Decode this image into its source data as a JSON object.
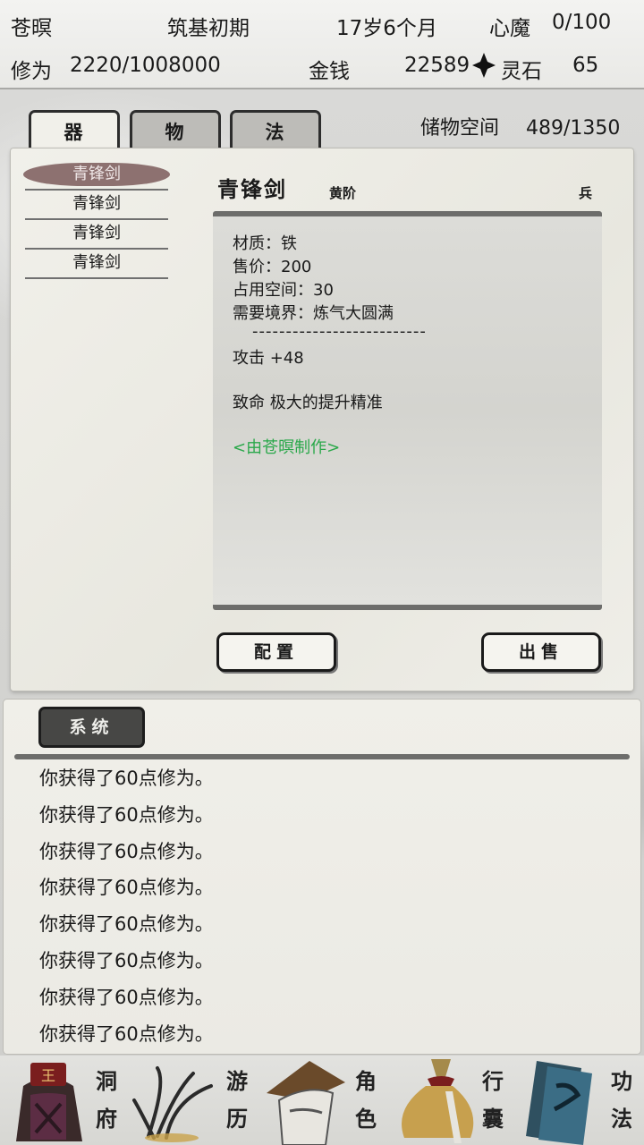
{
  "status": {
    "name": "苍暝",
    "realm": "筑基初期",
    "age": "17岁6个月",
    "demon_label": "心魔",
    "demon_value": "0/100",
    "cultivation_label": "修为",
    "cultivation_value": "2220/1008000",
    "money_label": "金钱",
    "money_value": "22589",
    "spirit_label": "灵石",
    "spirit_value": "65"
  },
  "tabs": [
    {
      "label": "器"
    },
    {
      "label": "物"
    },
    {
      "label": "法"
    }
  ],
  "storage": {
    "label": "储物空间",
    "value": "489/1350"
  },
  "items": [
    {
      "label": "青锋剑"
    },
    {
      "label": "青锋剑"
    },
    {
      "label": "青锋剑"
    },
    {
      "label": "青锋剑"
    }
  ],
  "detail": {
    "name": "青锋剑",
    "grade": "黄阶",
    "type": "兵",
    "lines": [
      "材质：铁",
      "售价：200",
      "占用空间：30",
      "需要境界：炼气大圆满",
      "--------------------------",
      "攻击 +48",
      "致命 极大的提升精准",
      "<由苍暝制作>"
    ]
  },
  "buttons": {
    "equip": "配置",
    "sell": "出售"
  },
  "log": {
    "tab_label": "系统",
    "lines": [
      "你获得了60点修为。",
      "你获得了60点修为。",
      "你获得了60点修为。",
      "你获得了60点修为。",
      "你获得了60点修为。",
      "你获得了60点修为。",
      "你获得了60点修为。",
      "你获得了60点修为。"
    ]
  },
  "nav": [
    {
      "top": "洞",
      "bottom": "府",
      "icon": "cave-dwelling-icon"
    },
    {
      "top": "游",
      "bottom": "历",
      "icon": "travel-icon"
    },
    {
      "top": "角",
      "bottom": "色",
      "icon": "character-icon"
    },
    {
      "top": "行",
      "bottom": "囊",
      "icon": "bag-icon"
    },
    {
      "top": "功",
      "bottom": "法",
      "icon": "scripture-icon"
    }
  ],
  "colors": {
    "selected_item": "#7b5a5a",
    "crafted_text": "#2aa84a"
  }
}
